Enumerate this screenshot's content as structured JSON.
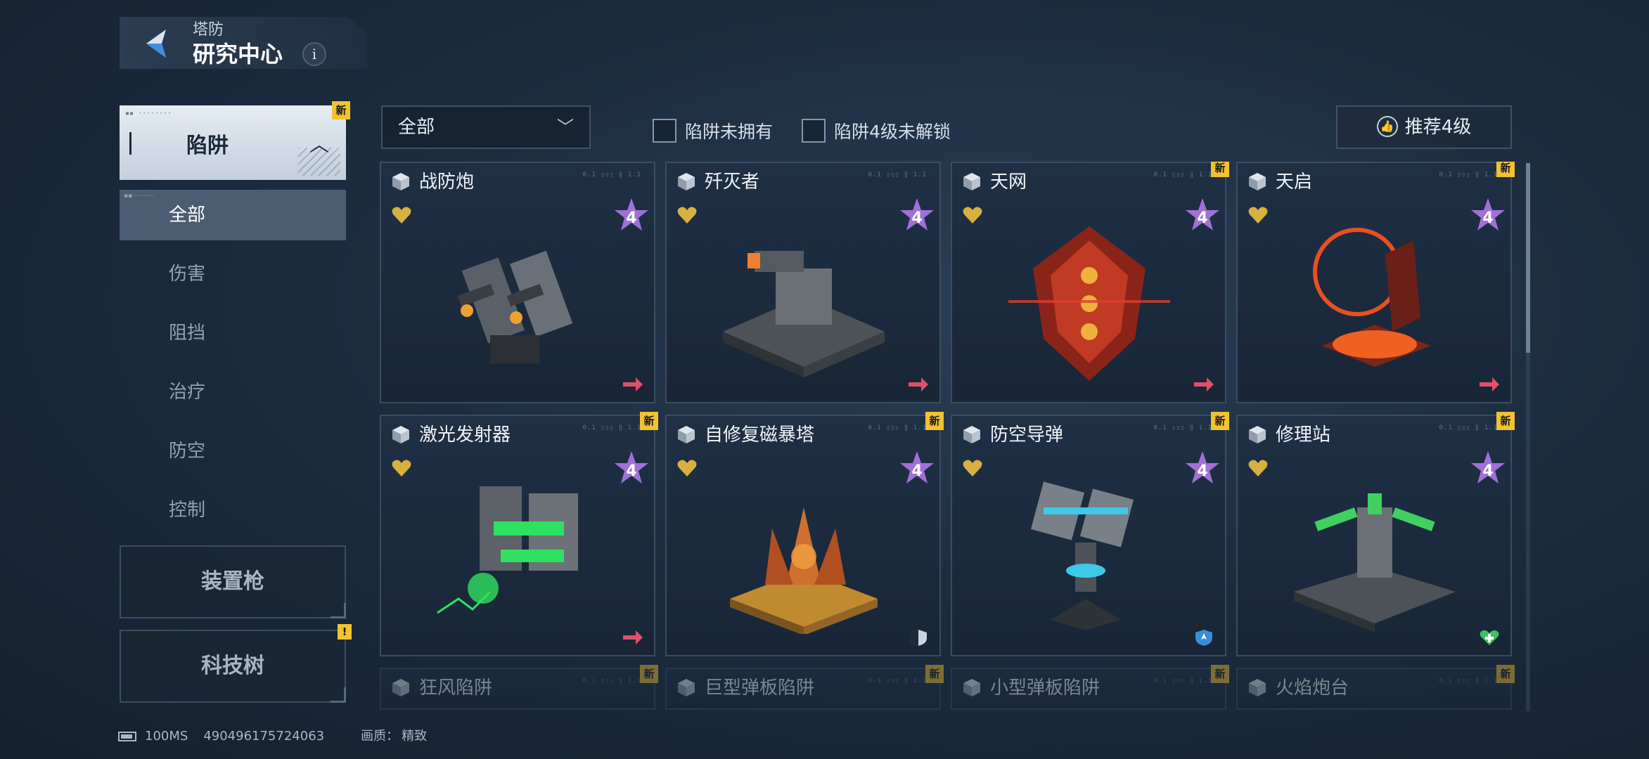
{
  "header": {
    "subtitle": "塔防",
    "title": "研究中心",
    "info_icon": "i"
  },
  "sidebar": {
    "main_tab": {
      "label": "陷阱",
      "badge": "新"
    },
    "items": [
      {
        "label": "全部",
        "active": true
      },
      {
        "label": "伤害"
      },
      {
        "label": "阻挡"
      },
      {
        "label": "治疗"
      },
      {
        "label": "防空"
      },
      {
        "label": "控制"
      }
    ],
    "boxes": [
      {
        "label": "装置枪"
      },
      {
        "label": "科技树",
        "badge": "!"
      }
    ]
  },
  "filters": {
    "dropdown_value": "全部",
    "checkbox1": "陷阱未拥有",
    "checkbox2": "陷阱4级未解锁",
    "recommend": "推荐4级"
  },
  "cards": [
    {
      "name": "战防炮",
      "level": "4",
      "new": false,
      "action_icon": "arrow-icon",
      "accent": "#f0a030"
    },
    {
      "name": "歼灭者",
      "level": "4",
      "new": false,
      "action_icon": "arrow-icon",
      "accent": "#f08030"
    },
    {
      "name": "天网",
      "level": "4",
      "new": true,
      "action_icon": "arrow-icon",
      "accent": "#d8402a"
    },
    {
      "name": "天启",
      "level": "4",
      "new": true,
      "action_icon": "arrow-icon",
      "accent": "#e85020"
    },
    {
      "name": "激光发射器",
      "level": "4",
      "new": true,
      "action_icon": "arrow-icon",
      "accent": "#30e060"
    },
    {
      "name": "自修复磁暴塔",
      "level": "4",
      "new": true,
      "action_icon": "shield-icon",
      "accent": "#f0a040"
    },
    {
      "name": "防空导弹",
      "level": "4",
      "new": true,
      "action_icon": "antiair-icon",
      "accent": "#40c8e8"
    },
    {
      "name": "修理站",
      "level": "4",
      "new": true,
      "action_icon": "heal-icon",
      "accent": "#40d060"
    },
    {
      "name": "狂风陷阱",
      "new": true
    },
    {
      "name": "巨型弹板陷阱",
      "new": true
    },
    {
      "name": "小型弹板陷阱",
      "new": true
    },
    {
      "name": "火焰炮台",
      "new": true
    }
  ],
  "status": {
    "latency": "100MS",
    "uid": "490496175724063",
    "quality_label": "画质：",
    "quality_value": "精致"
  },
  "colors": {
    "badge": "#f2c230",
    "accent_red": "#e0506a",
    "heart": "#d8b040",
    "star": "#a070d8"
  }
}
